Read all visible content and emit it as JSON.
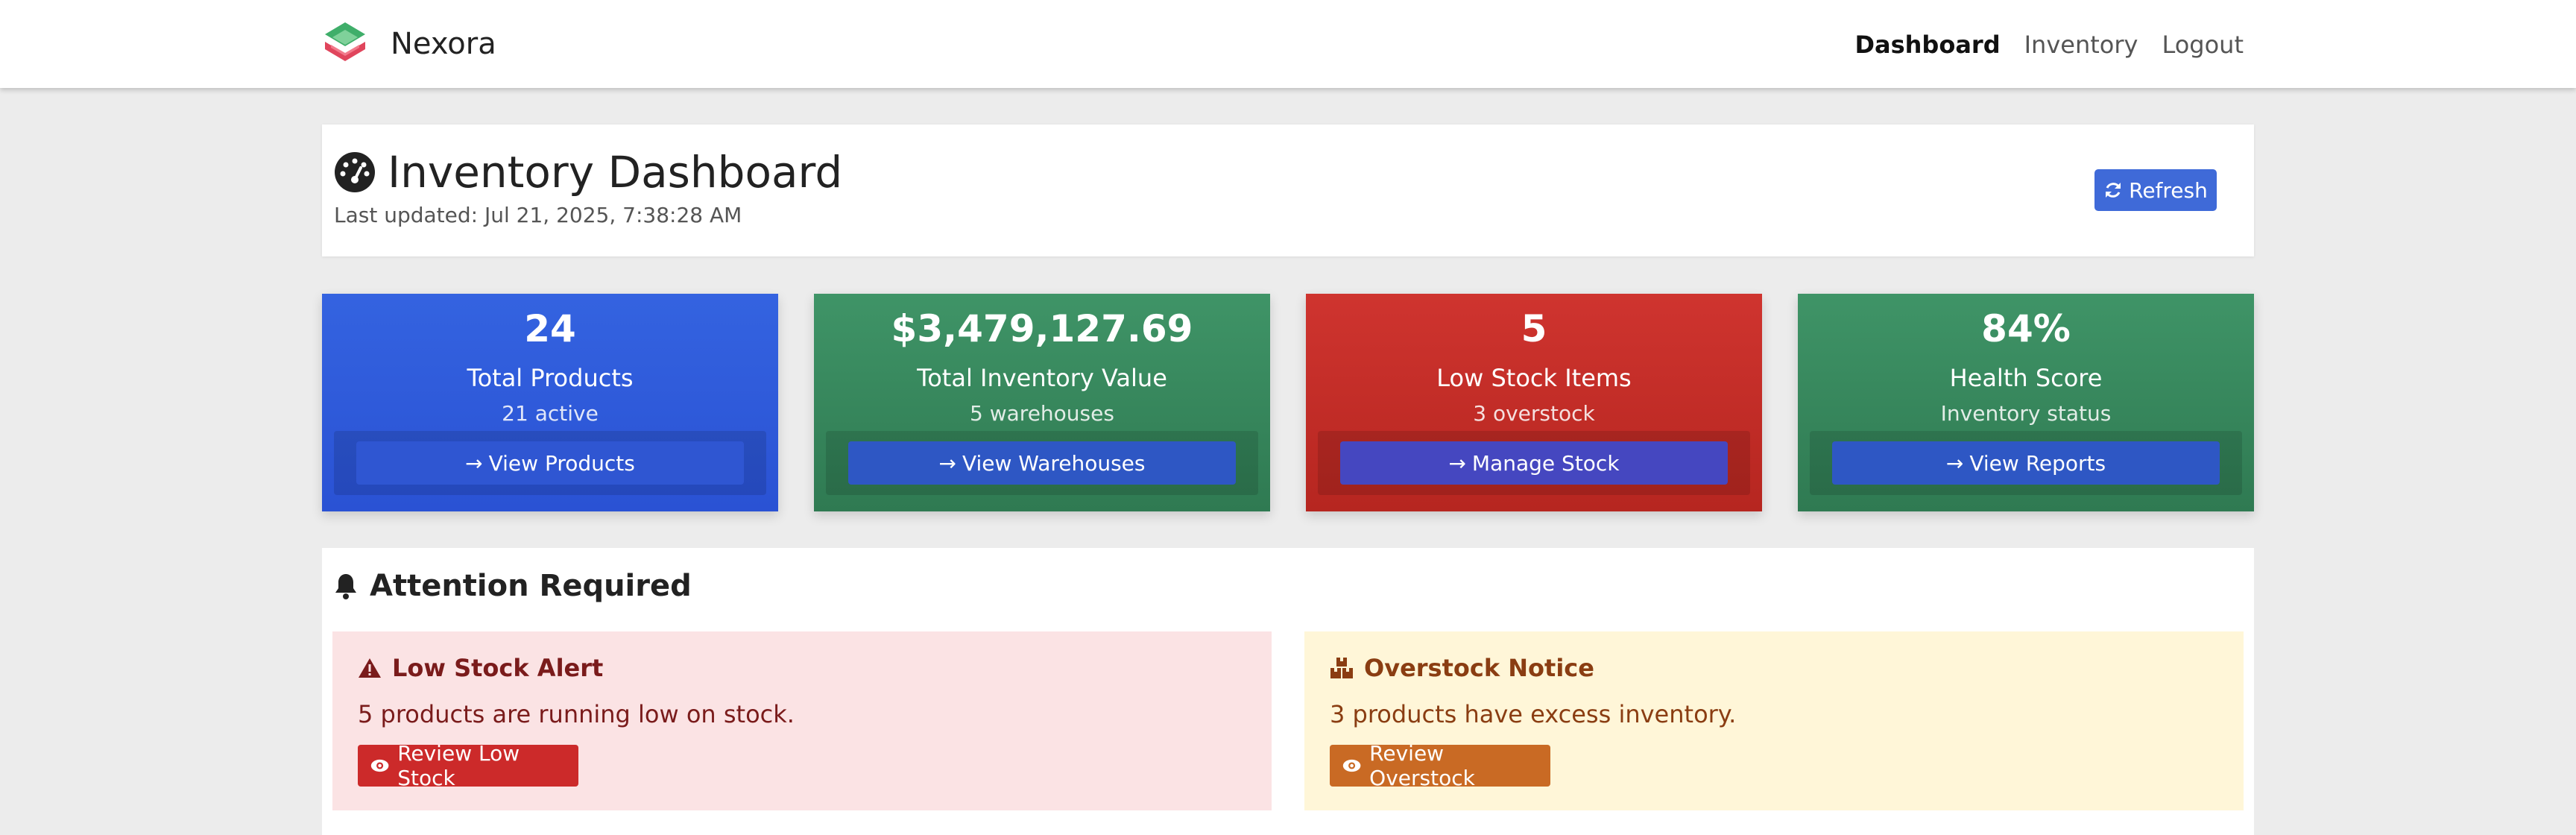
{
  "app": {
    "name": "Nexora",
    "logo_icon": "nexora-logo-icon"
  },
  "nav": {
    "links": [
      {
        "label": "Dashboard",
        "active": true
      },
      {
        "label": "Inventory",
        "active": false
      },
      {
        "label": "Logout",
        "active": false
      }
    ]
  },
  "header": {
    "icon": "tachometer-icon",
    "title": "Inventory Dashboard",
    "last_updated": "Last updated: Jul 21, 2025, 7:38:28 AM",
    "refresh_label": "Refresh",
    "refresh_icon": "refresh-icon",
    "accent_color": "#3f6ad8"
  },
  "stats": [
    {
      "value": "24",
      "label": "Total Products",
      "sub": "21 active",
      "button": "View Products",
      "color": "#2f5ad9"
    },
    {
      "value": "$3,479,127.69",
      "label": "Total Inventory Value",
      "sub": "5 warehouses",
      "button": "View Warehouses",
      "color": "#378a5d"
    },
    {
      "value": "5",
      "label": "Low Stock Items",
      "sub": "3 overstock",
      "button": "Manage Stock",
      "color": "#c42d28"
    },
    {
      "value": "84%",
      "label": "Health Score",
      "sub": "Inventory status",
      "button": "View Reports",
      "color": "#378a5d"
    }
  ],
  "attention": {
    "title": "Attention Required",
    "icon": "bell-icon",
    "alerts": [
      {
        "title": "Low Stock Alert",
        "icon": "warning-triangle-icon",
        "text": "5 products are running low on stock.",
        "button": "Review Low Stock",
        "button_icon": "eye-icon",
        "bg_color": "#fbe3e4",
        "button_color": "#cc2a2a"
      },
      {
        "title": "Overstock Notice",
        "icon": "boxes-icon",
        "text": "3 products have excess inventory.",
        "button": "Review Overstock",
        "button_icon": "eye-icon",
        "bg_color": "#fff6d8",
        "button_color": "#c96a24"
      }
    ]
  }
}
